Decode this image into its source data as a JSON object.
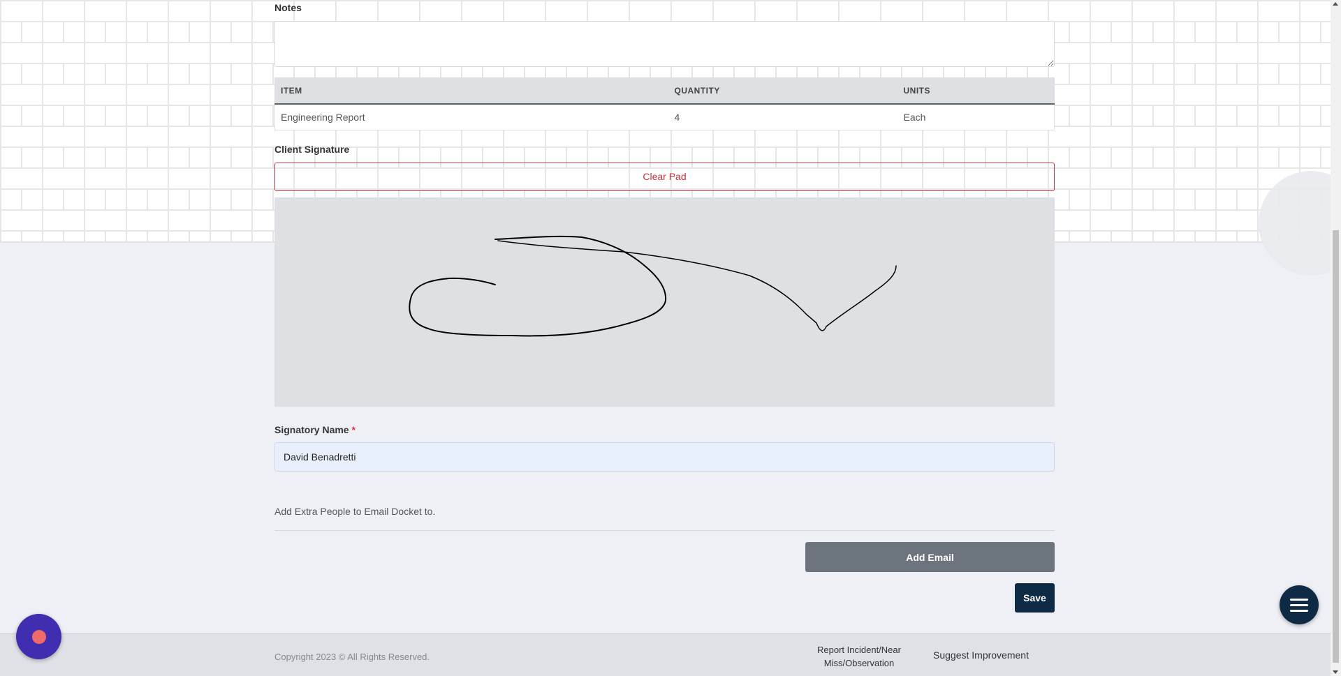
{
  "form": {
    "notes_label": "Notes",
    "notes_value": "",
    "items_table": {
      "columns": [
        "ITEM",
        "QUANTITY",
        "UNITS"
      ],
      "rows": [
        [
          "Engineering Report",
          "4",
          "Each"
        ]
      ]
    },
    "client_signature_label": "Client Signature",
    "clear_pad_label": "Clear Pad",
    "signatory_name_label": "Signatory Name",
    "required_marker": "*",
    "signatory_name_value": "David Benadretti",
    "extra_people_text": "Add Extra People to Email Docket to.",
    "add_email_label": "Add Email",
    "save_label": "Save"
  },
  "footer": {
    "copyright": "Copyright 2023 © All Rights Reserved.",
    "report_incident": "Report Incident/Near Miss/Observation",
    "suggest_improvement": "Suggest Improvement"
  },
  "icons": {
    "menu_fab": "hamburger-menu-icon",
    "record_fab": "record-icon"
  },
  "colors": {
    "primary_dark": "#0f2a44",
    "danger": "#c8303d",
    "secondary": "#6c757d",
    "record_fab": "#3f2fb0"
  }
}
